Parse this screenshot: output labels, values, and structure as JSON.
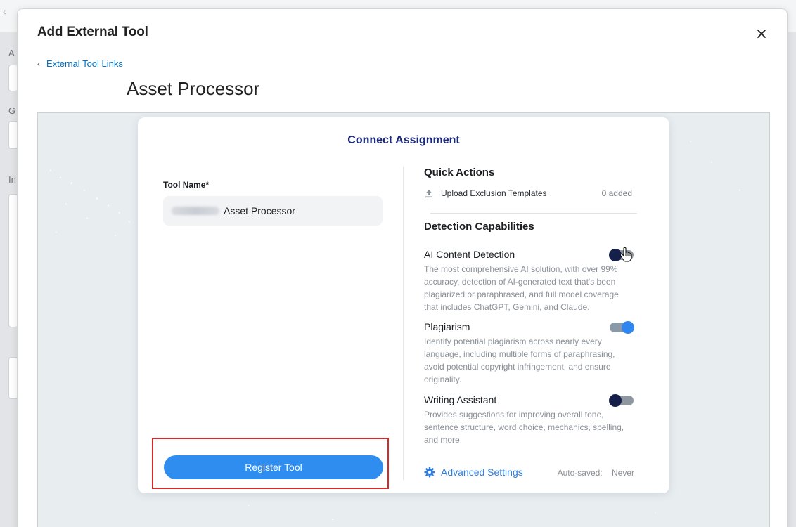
{
  "modal": {
    "title": "Add External Tool",
    "back_link": "External Tool Links",
    "page_title": "Asset Processor"
  },
  "card": {
    "title": "Connect Assignment",
    "tool_name_label": "Tool Name*",
    "tool_name_value": "Asset Processor",
    "register_label": "Register Tool"
  },
  "quick_actions": {
    "title": "Quick Actions",
    "upload_label": "Upload Exclusion Templates",
    "upload_count": "0 added"
  },
  "detection": {
    "title": "Detection Capabilities",
    "features": [
      {
        "name": "AI Content Detection",
        "desc": "The most comprehensive AI solution, with over 99% accuracy, detection of AI-generated text that's been plagiarized or paraphrased, and full model coverage that includes ChatGPT, Gemini, and Claude.",
        "enabled": false
      },
      {
        "name": "Plagiarism",
        "desc": "Identify potential plagiarism across nearly every language, including multiple forms of paraphrasing, avoid potential copyright infringement, and ensure originality.",
        "enabled": true
      },
      {
        "name": "Writing Assistant",
        "desc": "Provides suggestions for improving overall tone, sentence structure, word choice, mechanics, spelling, and more.",
        "enabled": false
      }
    ]
  },
  "footer": {
    "advanced_settings": "Advanced Settings",
    "autosaved_label": "Auto-saved:",
    "autosaved_value": "Never"
  },
  "colors": {
    "accent": "#2f8df0",
    "link": "#006fbf",
    "card_title": "#1c2a7a",
    "highlight_border": "#d32a2a"
  }
}
